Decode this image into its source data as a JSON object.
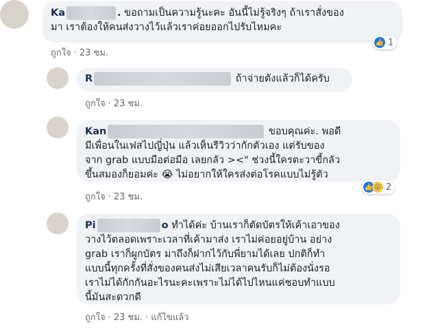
{
  "comments": [
    {
      "author": "Ka",
      "line1": "ขอถามเป็นความรู้นะคะ อันนี้ไม่รู้จริงๆ ถ้าเราสั่งของ",
      "line2": "มา เราต้องให้คนส่งวางไว้แล้วเราค่อยออกไปรับไหมคะ",
      "like": "ถูกใจ",
      "time": "23 ชม.",
      "reaction_count": "1",
      "reaction_icons": [
        "like-icon"
      ]
    },
    {
      "author": "R",
      "line1": "ถ้าจ่ายตังแล้วก็ได้ครับ",
      "like": "ถูกใจ",
      "time": "23 ชม."
    },
    {
      "author": "Kan",
      "line1": "ขอบคุณค่ะ. พอดี",
      "line2": "มีเพื่อนในเฟสไปญี่ปุ่น แล้วเห็นรีวิวว่ากักตัวเอง แต่รับของ",
      "line3": "จาก grab แบบมือต่อมือ เลยกลัว ><\" ช่วงนี้ใครตะวาขี้กลัว",
      "line4": "ขึ้นสมองก็ยอมค่ะ 😭 ไม่อยากให้ใครส่งต่อโรคแบบไม่รู้ตัว",
      "like": "ถูกใจ",
      "time": "23 ชม.",
      "reaction_count": "2",
      "reaction_icons": [
        "like-icon",
        "wow-icon"
      ]
    },
    {
      "author": "Pi",
      "author_tail": "o",
      "line1": "ทำได้ค่ะ บ้านเราก็ตัดบัตรให้เค้าเอาของ",
      "line2": "วางไว้ตลอดเพราะเวลาที่เค้ามาส่ง เราไม่ค่อยอยู่บ้าน อย่าง",
      "line3": "grab เราก็ผูกบัตร มาถึงก็ฝากไว้กับพี่ยามได้เลย ปกติก็ทำ",
      "line4": "แบบนี้ทุกครั้งที่สั่งของคนส่งไม่เสียเวลาคนรับก็ไม่ต้องนั่งรอ",
      "line5": "เราไม่ได้กักกันอะไรนะคะเพราะไม่ได้ไปไหนแค่ชอบทำแบบ",
      "line6": "นี้มันสะดวกดี",
      "like": "ถูกใจ",
      "time": "23 ชม.",
      "edited": "แก้ไขแล้ว"
    }
  ]
}
